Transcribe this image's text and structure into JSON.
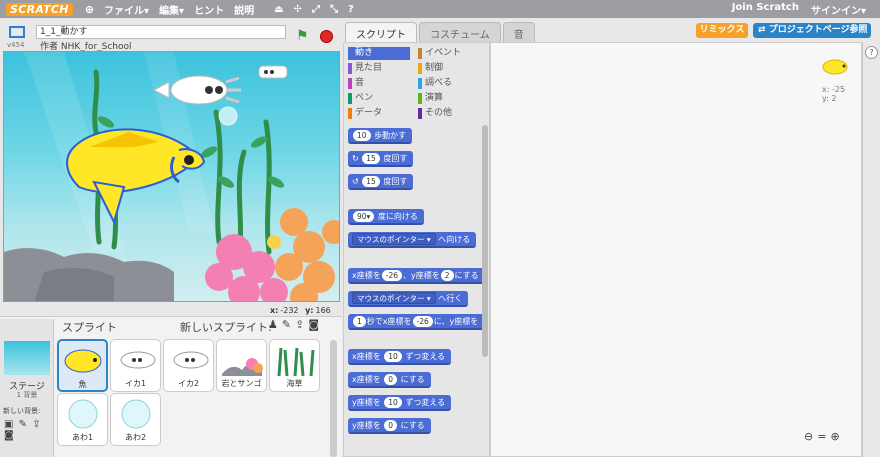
{
  "menubar": {
    "logo": "SCRATCH",
    "items": [
      "ファイル▾",
      "編集▾",
      "ヒント",
      "説明"
    ],
    "right": [
      "Join Scratch",
      "サインイン▾"
    ]
  },
  "stage_header": {
    "project_name": "1_1_動かす",
    "author": "作者 NHK_for_School",
    "version": "v454"
  },
  "coords": {
    "x_label": "x:",
    "x": "-232",
    "y_label": "y:",
    "y": "166"
  },
  "sprites_panel": {
    "title": "スプライト",
    "new_sprite": "新しいスプライト:",
    "stage_label": "ステージ",
    "stage_count": "1 背景",
    "new_bg": "新しい背景:",
    "sprites": [
      {
        "name": "魚"
      },
      {
        "name": "イカ1"
      },
      {
        "name": "イカ2"
      },
      {
        "name": "岩とサンゴ"
      },
      {
        "name": "海草"
      },
      {
        "name": "あわ1"
      },
      {
        "name": "あわ2"
      }
    ]
  },
  "tabs": [
    "スクリプト",
    "コスチューム",
    "音"
  ],
  "top_buttons": {
    "remix": "リミックス",
    "project_page": "プロジェクトページ参照"
  },
  "categories": [
    {
      "label": "動き",
      "color": "#4a6cd4"
    },
    {
      "label": "イベント",
      "color": "#c88330"
    },
    {
      "label": "見た目",
      "color": "#8a55d7"
    },
    {
      "label": "制御",
      "color": "#e1a91a"
    },
    {
      "label": "音",
      "color": "#bb42c3"
    },
    {
      "label": "調べる",
      "color": "#2ca5e2"
    },
    {
      "label": "ペン",
      "color": "#0e9a6c"
    },
    {
      "label": "演算",
      "color": "#5cb712"
    },
    {
      "label": "データ",
      "color": "#ee7d16"
    },
    {
      "label": "その他",
      "color": "#632d99"
    }
  ],
  "blocks": {
    "move": {
      "v": "10",
      "t": "歩動かす"
    },
    "turn_r": {
      "v": "15",
      "t": "度回す"
    },
    "turn_l": {
      "v": "15",
      "t": "度回す"
    },
    "point_dir": {
      "v": "90▾",
      "t": "度に向ける"
    },
    "point_to": {
      "dd": "マウスのポインター ▾",
      "t": "へ向ける"
    },
    "goto_xy": {
      "a": "x座標を",
      "x": "-26",
      "b": "、y座標を",
      "y": "2",
      "c": "にする"
    },
    "goto": {
      "dd": "マウスのポインター ▾",
      "t": "へ行く"
    },
    "glide": {
      "s": "1",
      "a": "秒でx座標を",
      "x": "-26",
      "b": "に、y座標を"
    },
    "change_x": {
      "a": "x座標を",
      "v": "10",
      "b": "ずつ変える"
    },
    "set_x": {
      "a": "x座標を",
      "v": "0",
      "b": "にする"
    },
    "change_y": {
      "a": "y座標を",
      "v": "10",
      "b": "ずつ変える"
    },
    "set_y": {
      "a": "y座標を",
      "v": "0",
      "b": "にする"
    }
  },
  "sprite_info": {
    "x": "x: -25",
    "y": "y: 2"
  }
}
